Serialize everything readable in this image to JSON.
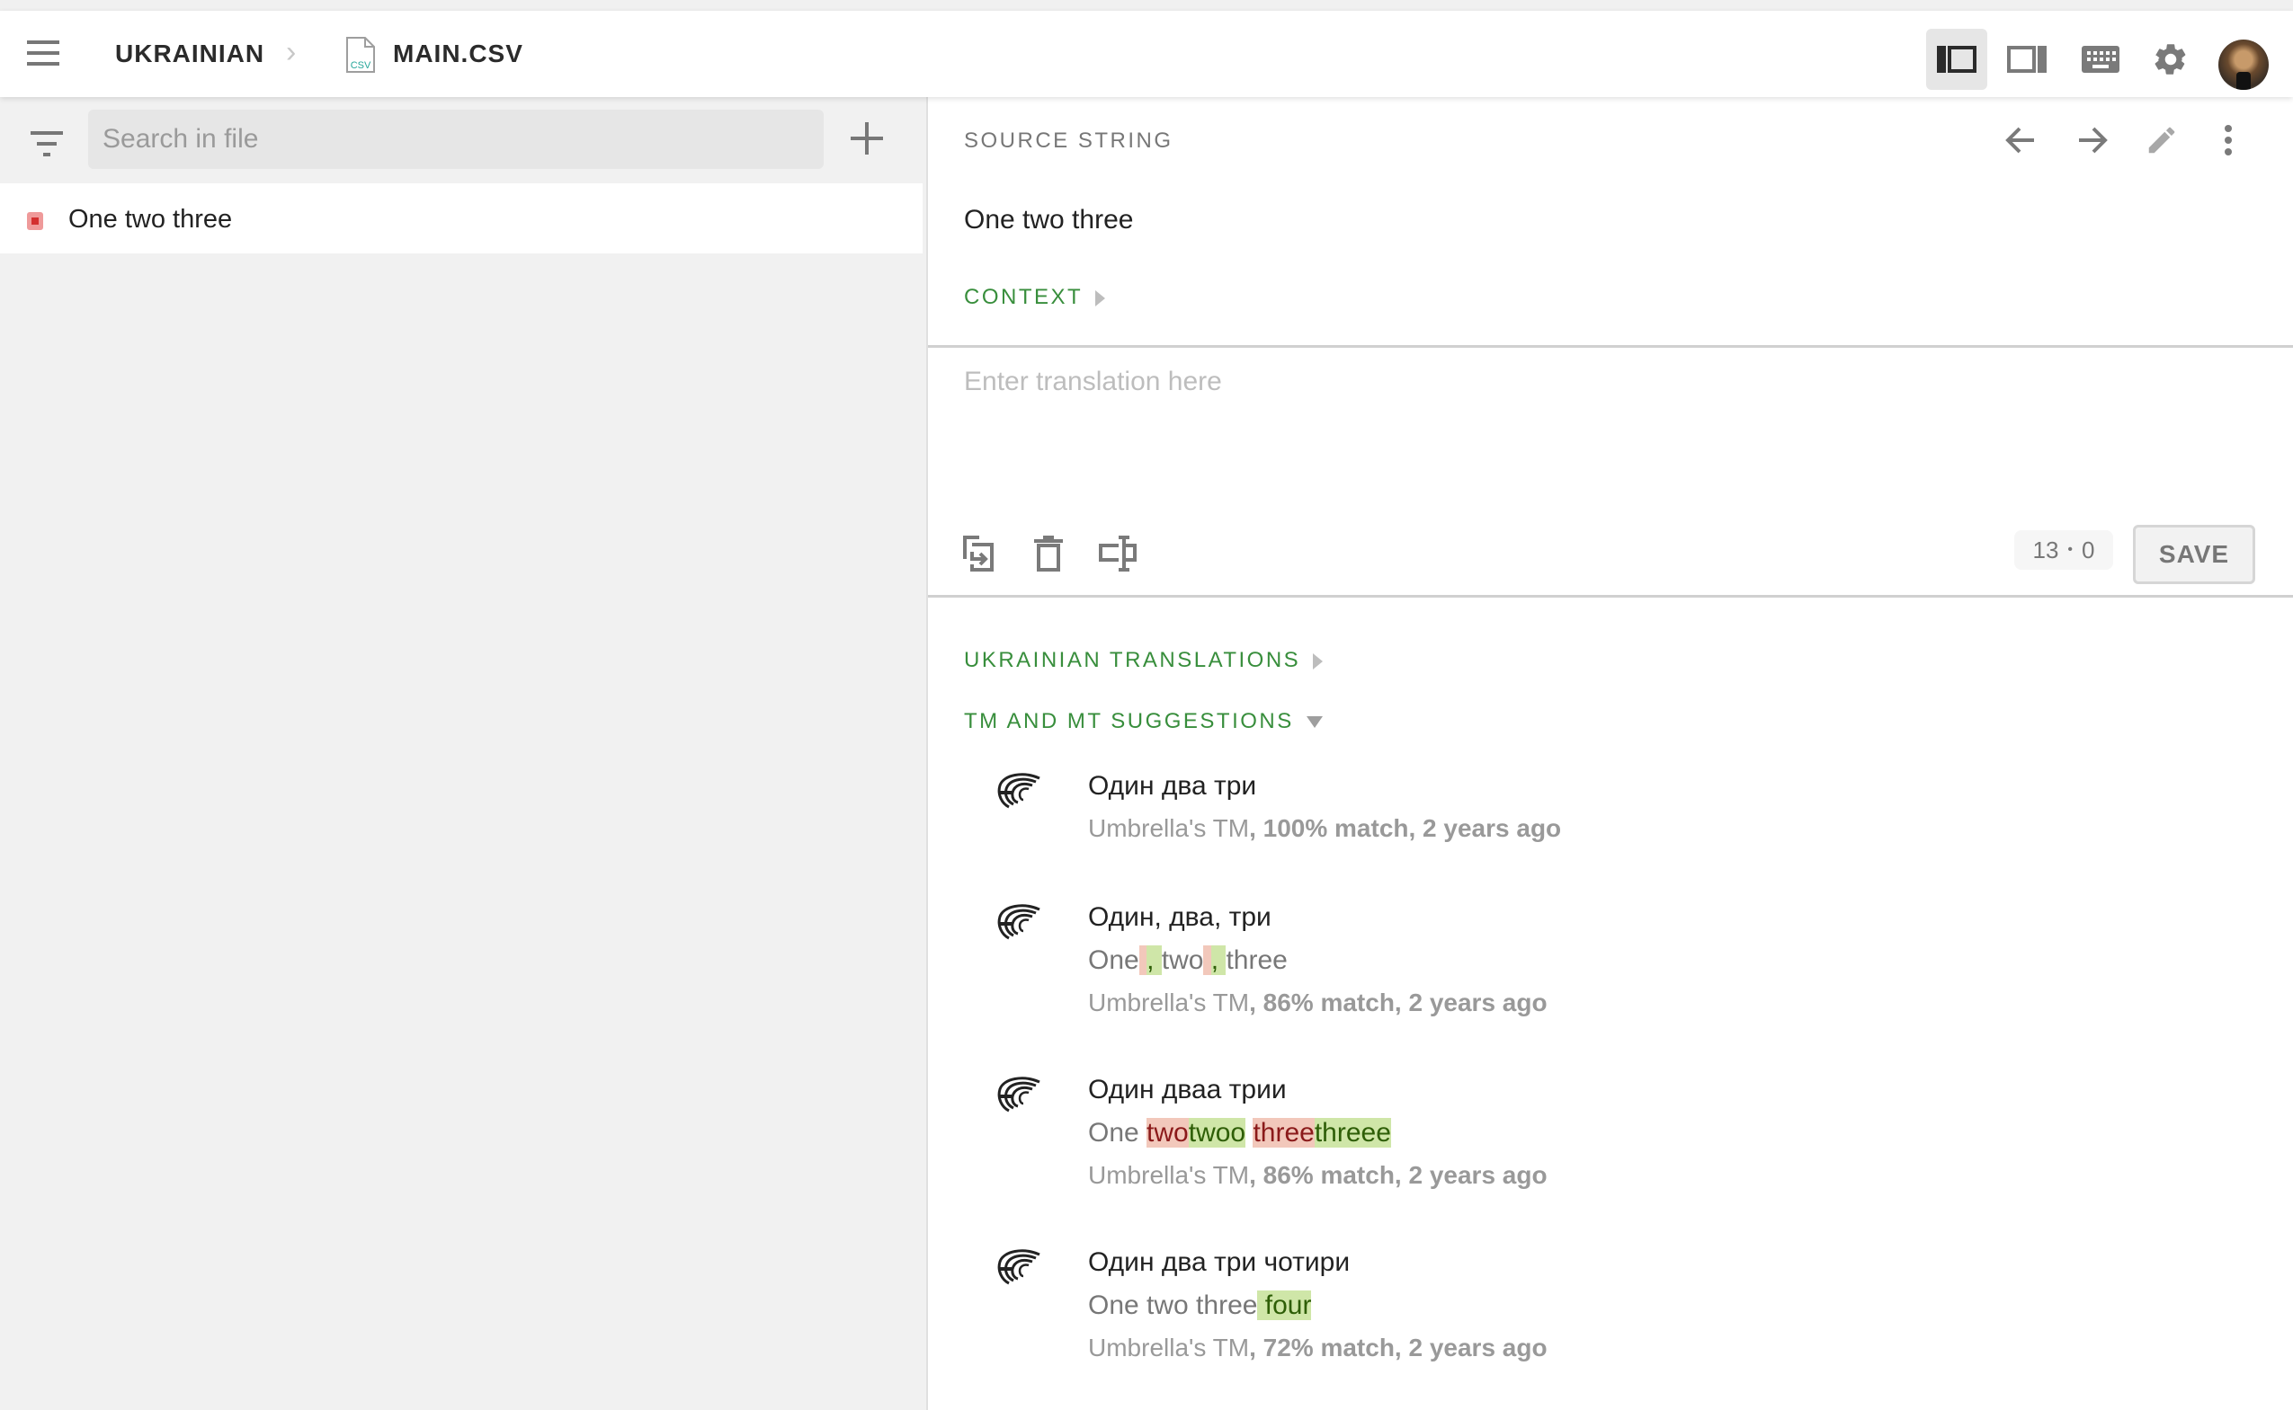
{
  "header": {
    "breadcrumb": {
      "language": "UKRAINIAN",
      "separator": "›",
      "file_icon_label": "CSV",
      "file": "MAIN.CSV"
    },
    "icons": [
      "menu-icon",
      "sidebar-left-icon",
      "sidebar-right-icon",
      "keyboard-icon",
      "gear-icon",
      "avatar"
    ],
    "active_layout": "sidebar-left"
  },
  "left_panel": {
    "search": {
      "placeholder": "Search in file",
      "value": ""
    },
    "strings": [
      {
        "text": "One two three",
        "status": "untranslated",
        "status_color": "#d32f2f"
      }
    ]
  },
  "source": {
    "label": "SOURCE STRING",
    "text": "One two three",
    "context_label": "CONTEXT"
  },
  "editor": {
    "placeholder": "Enter translation here",
    "value": "",
    "counter_source": "13",
    "counter_sep": "•",
    "counter_target": "0",
    "save_label": "SAVE"
  },
  "sections": {
    "translations_label": "UKRAINIAN TRANSLATIONS",
    "suggestions_label": "TM AND MT SUGGESTIONS"
  },
  "suggestions": [
    {
      "target": "Один два три",
      "source_diff": [],
      "meta_prefix": "Umbrella's TM",
      "meta_rest": ", 100% match, 2 years ago"
    },
    {
      "target": "Один, два, три",
      "source_diff": [
        {
          "t": "One",
          "k": "eq"
        },
        {
          "t": " ",
          "k": "del"
        },
        {
          "t": ", ",
          "k": "ins"
        },
        {
          "t": "two",
          "k": "eq"
        },
        {
          "t": " ",
          "k": "del"
        },
        {
          "t": ", ",
          "k": "ins"
        },
        {
          "t": "three",
          "k": "eq"
        }
      ],
      "meta_prefix": "Umbrella's TM",
      "meta_rest": ", 86% match, 2 years ago"
    },
    {
      "target": "Один дваа трии",
      "source_diff": [
        {
          "t": "One ",
          "k": "eq"
        },
        {
          "t": "two",
          "k": "del"
        },
        {
          "t": "twoo",
          "k": "ins"
        },
        {
          "t": " ",
          "k": "eq"
        },
        {
          "t": "three",
          "k": "del"
        },
        {
          "t": "threee",
          "k": "ins"
        }
      ],
      "meta_prefix": "Umbrella's TM",
      "meta_rest": ", 86% match, 2 years ago"
    },
    {
      "target": "Один два три чотири",
      "source_diff": [
        {
          "t": "One two three",
          "k": "eq"
        },
        {
          "t": " four",
          "k": "ins"
        }
      ],
      "meta_prefix": "Umbrella's TM",
      "meta_rest": ", 72% match, 2 years ago"
    }
  ],
  "colors": {
    "accent_green": "#388e3c",
    "diff_deleted_bg": "#f2c8bb",
    "diff_inserted_bg": "#cfe6a8"
  }
}
